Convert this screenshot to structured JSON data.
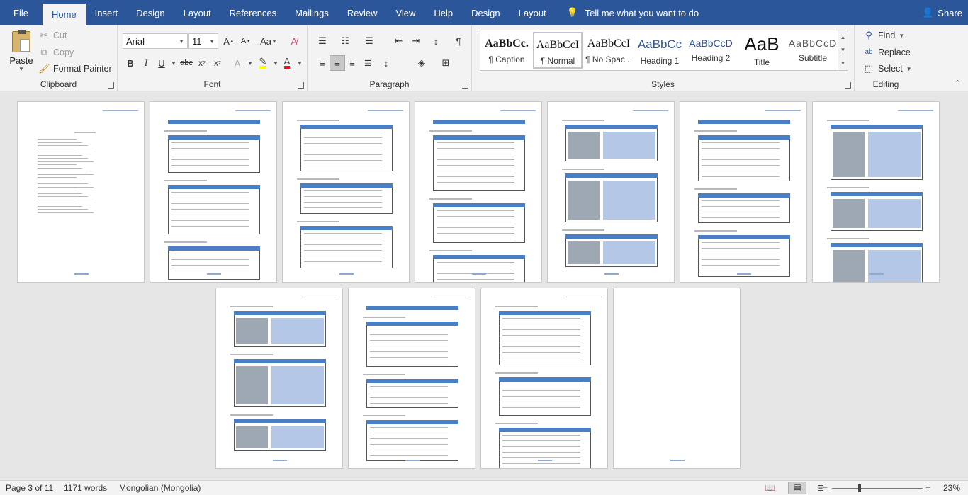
{
  "tabs": [
    "File",
    "Home",
    "Insert",
    "Design",
    "Layout",
    "References",
    "Mailings",
    "Review",
    "View",
    "Help",
    "Design",
    "Layout"
  ],
  "active_tab": "Home",
  "tell_me": "Tell me what you want to do",
  "share": "Share",
  "clipboard": {
    "label": "Clipboard",
    "paste": "Paste",
    "cut": "Cut",
    "copy": "Copy",
    "format_painter": "Format Painter"
  },
  "font": {
    "label": "Font",
    "name": "Arial",
    "size": "11"
  },
  "paragraph": {
    "label": "Paragraph"
  },
  "styles": {
    "label": "Styles",
    "items": [
      {
        "preview": "AaBbCc.",
        "name": "¶ Caption"
      },
      {
        "preview": "AaBbCcI",
        "name": "¶ Normal"
      },
      {
        "preview": "AaBbCcI",
        "name": "¶ No Spac..."
      },
      {
        "preview": "AaBbCc",
        "name": "Heading 1"
      },
      {
        "preview": "AaBbCcD",
        "name": "Heading 2"
      },
      {
        "preview": "AaB",
        "name": "Title"
      },
      {
        "preview": "AaBbCcD",
        "name": "Subtitle"
      }
    ],
    "colors": [
      "#111111",
      "#111111",
      "#111111",
      "#2f5597",
      "#2f5597",
      "#111111",
      "#595959"
    ]
  },
  "editing": {
    "label": "Editing",
    "find": "Find",
    "replace": "Replace",
    "select": "Select"
  },
  "status": {
    "page": "Page 3 of 11",
    "words": "1171 words",
    "language": "Mongolian (Mongolia)",
    "zoom": "23%"
  },
  "colors": {
    "brand": "#2b579a",
    "ribbon": "#f3f3f3",
    "canvas": "#e6e6e6"
  }
}
